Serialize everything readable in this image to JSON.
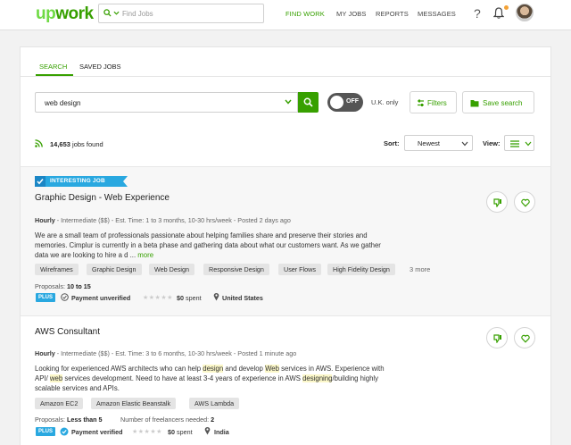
{
  "header": {
    "logo": "upwork",
    "search_placeholder": "Find Jobs",
    "nav": [
      "FIND WORK",
      "MY JOBS",
      "REPORTS",
      "MESSAGES"
    ],
    "help_icon": "?"
  },
  "tabs": [
    "SEARCH",
    "SAVED JOBS"
  ],
  "search": {
    "query": "web design",
    "toggle_label": "OFF",
    "uk_only": "U.K. only",
    "filters_label": "Filters",
    "save_search_label": "Save search"
  },
  "results": {
    "count": "14,653",
    "count_suffix": "jobs found",
    "sort_label": "Sort:",
    "sort_value": "Newest",
    "view_label": "View:"
  },
  "jobs": [
    {
      "badge": "INTERESTING JOB",
      "title": "Graphic Design - Web Experience",
      "type": "Hourly",
      "meta_rest": " - Intermediate ($$) - Est. Time: 1 to 3 months, 10-30 hrs/week - Posted 2 days ago",
      "desc_line1": "We are a small team of professionals passionate about helping families share and preserve their stories and",
      "desc_line2": "memories. Cimplur is currently in a beta phase and gathering data about what our customers want. As we gather",
      "desc_line3": "data we are looking to hire a d ...",
      "more_label": "more",
      "skills": [
        "Wireframes",
        "Graphic Design",
        "Web Design",
        "Responsive Design",
        "User Flows",
        "High Fidelity Design"
      ],
      "more_skills": "3 more",
      "proposals_label": "Proposals:",
      "proposals_value": "10 to 15",
      "plus": "PLUS",
      "payment": "Payment unverified",
      "stars": "★★★★★",
      "spent_value": "$0",
      "spent_label": "spent",
      "location": "United States"
    },
    {
      "title": "AWS Consultant",
      "type": "Hourly",
      "meta_rest": " - Intermediate ($$) - Est. Time: 3 to 6 months, 10-30 hrs/week - Posted 1 minute ago",
      "desc_a": "Looking for experienced AWS architects who can help ",
      "desc_hl1": "design",
      "desc_b": " and develop ",
      "desc_hl2": "Web",
      "desc_c": " services in AWS. Experience with",
      "desc_d": "API/ ",
      "desc_hl3": "web",
      "desc_e": " services development. Need to have at least 3-4 years of experience in AWS ",
      "desc_hl4": "designing",
      "desc_f": "/building highly",
      "desc_g": "scalable services and APIs.",
      "skills": [
        "Amazon EC2",
        "Amazon Elastic Beanstalk",
        "AWS Lambda"
      ],
      "proposals_label": "Proposals:",
      "proposals_value": "Less than 5",
      "freelancers_label": "Number of freelancers needed:",
      "freelancers_value": "2",
      "plus": "PLUS",
      "payment": "Payment verified",
      "stars": "★★★★★",
      "spent_value": "$0",
      "spent_label": "spent",
      "location": "India"
    }
  ],
  "colors": {
    "brand": "#37a000",
    "brand_light": "#6fda44",
    "badge": "#29a8e0"
  }
}
